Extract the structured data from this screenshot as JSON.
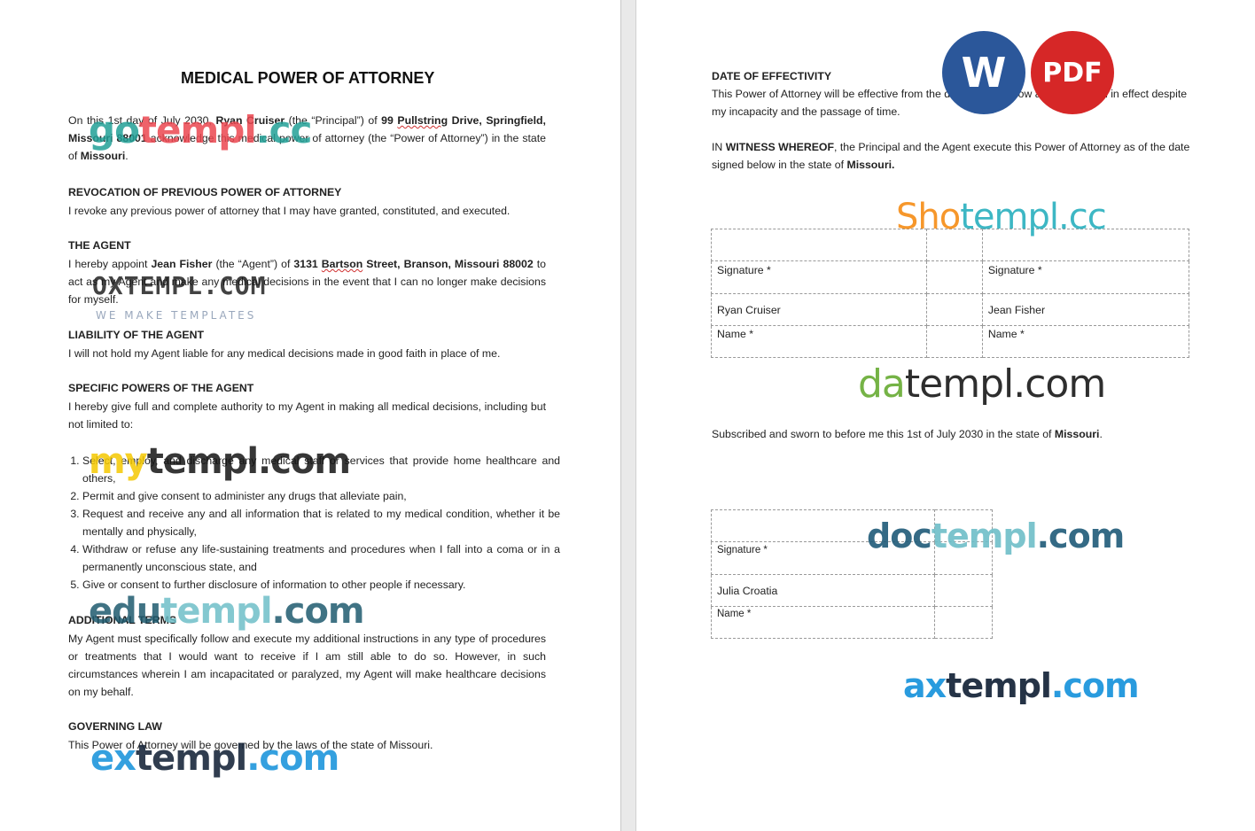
{
  "left": {
    "title": "MEDICAL POWER OF ATTORNEY",
    "intro": {
      "t1": "On this 1st day of July 2030, ",
      "principal": "Ryan Cruiser",
      "t2": " (the “Principal”) of ",
      "addr1": "99 ",
      "addr2": "Pullstring",
      "addr3": " Drive, Springfield, Missouri 88001",
      "t3": " acknowledge this medical power of attorney (the “Power of Attorney”) in the state of ",
      "state": "Missouri",
      "t4": "."
    },
    "revocation": {
      "heading": "REVOCATION OF PREVIOUS POWER OF ATTORNEY",
      "text": "I revoke any previous power of attorney that I may have granted, constituted, and executed."
    },
    "agent": {
      "heading": "THE AGENT",
      "t1": "I hereby appoint ",
      "name": "Jean Fisher",
      "t2": " (the “Agent”) of ",
      "addr1": "3131 ",
      "addr2": "Bartson",
      "addr3": " Street, Branson, Missouri 88002",
      "t3": " to act as my Agent and make any medical decisions in the event that I can no longer make decisions for myself."
    },
    "liability": {
      "heading": "LIABILITY OF THE AGENT",
      "text": "I will not hold my Agent liable for any medical decisions made in good faith in place of me."
    },
    "powers": {
      "heading": "SPECIFIC POWERS OF THE AGENT",
      "text": "I hereby give full and complete authority to my Agent in making all medical decisions, including but not limited to:",
      "items": [
        "Select, employ, and discharge any medical staff or services that provide home healthcare and others,",
        "Permit and give consent to administer any drugs that alleviate pain,",
        "Request and receive any and all information that is related to my medical condition, whether it be mentally and physically,",
        "Withdraw or refuse any life-sustaining treatments and procedures when I fall into a coma or in a permanently unconscious state, and",
        "Give or consent to further disclosure of information to other people if necessary."
      ]
    },
    "additional": {
      "heading": "ADDITIONAL TERMS",
      "text": "My Agent must specifically follow and execute my additional instructions in any type of procedures or treatments that I would want to receive if I am still able to do so. However, in such circumstances wherein I am incapacitated or paralyzed, my Agent will make healthcare decisions on my behalf."
    },
    "governing": {
      "heading": "GOVERNING LAW",
      "text": "This Power of Attorney will be governed by the laws of the state of Missouri."
    }
  },
  "right": {
    "effectivity": {
      "heading": "DATE OF EFFECTIVITY",
      "text": "This Power of Attorney will be effective from the date signed below and will remain in effect despite my incapacity and the passage of time."
    },
    "witness": {
      "t1": "IN ",
      "bold": "WITNESS WHEREOF",
      "t2": ", the Principal and the Agent execute this Power of Attorney as of the date signed below in the state of ",
      "state": "Missouri."
    },
    "sig_table": {
      "sig_label": "Signature *",
      "name_label": "Name *",
      "principal_name": "Ryan Cruiser",
      "agent_name": "Jean Fisher"
    },
    "sworn": {
      "t1": "Subscribed and sworn to before me this 1st of July 2030 in the state of ",
      "state": "Missouri",
      "t2": "."
    },
    "notary_table": {
      "sig_label": "Signature *",
      "name": "Julia Croatia",
      "name_label": "Name *"
    }
  },
  "badges": {
    "word": "W",
    "pdf": "PDF"
  },
  "watermarks": {
    "gotempl": [
      "go",
      "templ",
      ".cc"
    ],
    "oxtempl": [
      "OXTEMPL.COM",
      "WE MAKE TEMPLATES"
    ],
    "mytempl": [
      "my",
      "templ.com"
    ],
    "edutempl": [
      "edu",
      "templ",
      ".com"
    ],
    "extempl": [
      "ex",
      "templ",
      ".com"
    ],
    "shotempl": [
      "Sho",
      "templ.cc"
    ],
    "datempl": [
      "da",
      "templ.com"
    ],
    "doctempl": [
      "doc",
      "templ",
      ".com"
    ],
    "axtempl": [
      "ax",
      "templ",
      ".com"
    ]
  },
  "colors": {
    "word": "#2b579a",
    "pdf": "#d62727"
  }
}
